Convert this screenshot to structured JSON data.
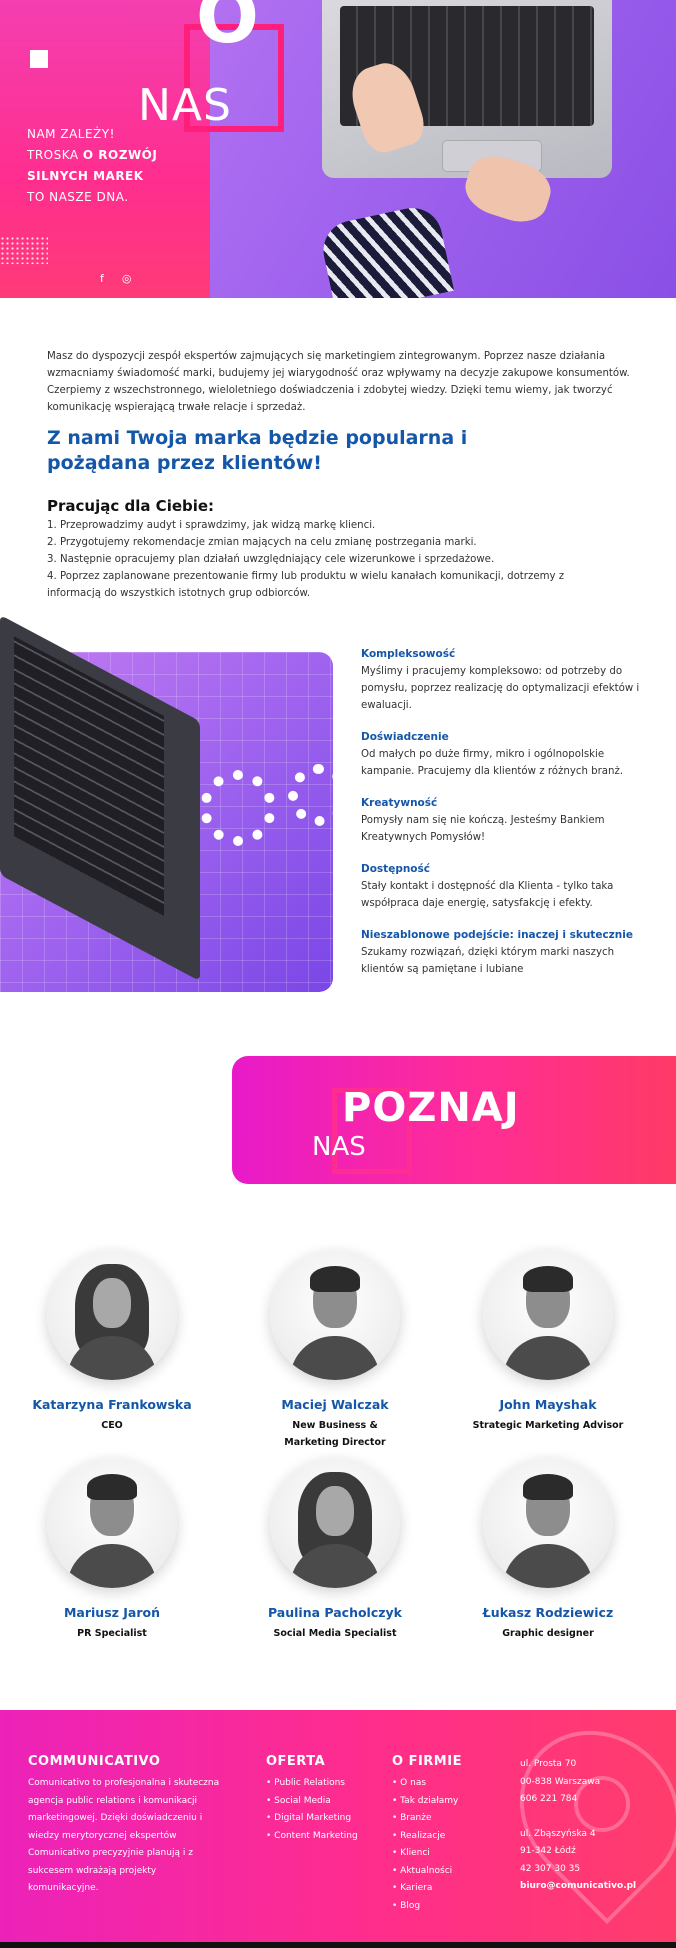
{
  "hero": {
    "title_o": "O",
    "title_nas": "NAS",
    "line1": "NAM ZALEŻY!",
    "line2_prefix": "TROSKA ",
    "line2_bold": "O ROZWÓJ",
    "line3": "SILNYCH MAREK",
    "line4": "TO NASZE DNA.",
    "social": {
      "facebook": "f",
      "instagram": "◎"
    }
  },
  "intro": {
    "paragraph": "Masz do dyspozycji zespół ekspertów zajmujących się marketingiem zintegrowanym. Poprzez nasze działania wzmacniamy świadomość marki, budujemy jej wiarygodność oraz wpływamy na decyzje zakupowe konsumentów. Czerpiemy z wszechstronnego, wieloletniego doświadczenia i zdobytej wiedzy. Dzięki temu wiemy, jak tworzyć komunikację wspierającą trwałe relacje i sprzedaż.",
    "slogan": "Z nami Twoja marka będzie popularna i pożądana przez klientów!",
    "working_title": "Pracując dla Ciebie:",
    "steps": [
      "1. Przeprowadzimy audyt i sprawdzimy, jak widzą markę klienci.",
      "2. Przygotujemy rekomendacje zmian mających na celu zmianę postrzegania marki.",
      "3. Następnie opracujemy plan działań uwzględniający cele wizerunkowe i sprzedażowe.",
      "4. Poprzez zaplanowane prezentowanie firmy lub produktu w wielu kanałach komunikacji, dotrzemy z informacją do wszystkich istotnych grup odbiorców."
    ]
  },
  "features": [
    {
      "title": "Kompleksowość",
      "desc": "Myślimy i pracujemy kompleksowo: od potrzeby do pomysłu, poprzez realizację do optymalizacji efektów i ewaluacji."
    },
    {
      "title": "Doświadczenie",
      "desc": "Od małych po duże firmy, mikro i ogólnopolskie kampanie. Pracujemy dla klientów z różnych branż."
    },
    {
      "title": "Kreatywność",
      "desc": "Pomysły nam się nie kończą. Jesteśmy Bankiem Kreatywnych Pomysłów!"
    },
    {
      "title": "Dostępność",
      "desc": "Stały kontakt i dostępność dla Klienta - tylko taka współpraca daje energię, satysfakcję i efekty."
    },
    {
      "title": "Nieszablonowe podejście: inaczej i skutecznie",
      "desc": "Szukamy rozwiązań, dzięki którym marki naszych klientów są pamiętane i lubiane"
    }
  ],
  "poznaj": {
    "big": "POZNAJ",
    "small": "NAS"
  },
  "team": [
    {
      "name": "Katarzyna Frankowska",
      "role": "CEO"
    },
    {
      "name": "Maciej Walczak",
      "role": "New Business & Marketing Director"
    },
    {
      "name": "John Mayshak",
      "role": "Strategic Marketing Advisor"
    },
    {
      "name": "Mariusz Jaroń",
      "role": "PR Specialist"
    },
    {
      "name": "Paulina Pacholczyk",
      "role": "Social Media Specialist"
    },
    {
      "name": "Łukasz Rodziewicz",
      "role": "Graphic designer"
    }
  ],
  "footer": {
    "brand": "COMMUNICATIVO",
    "about": "Comunicativo to profesjonalna i skuteczna agencja public relations i komunikacji marketingowej. Dzięki doświadczeniu i wiedzy merytorycznej ekspertów Comunicativo precyzyjnie planują i z sukcesem wdrażają projekty komunikacyjne.",
    "oferta_title": "OFERTA",
    "oferta": [
      "Public Relations",
      "Social Media",
      "Digital Marketing",
      "Content Marketing"
    ],
    "firma_title": "O FIRMIE",
    "firma": [
      "O nas",
      "Tak działamy",
      "Branże",
      "Realizacje",
      "Klienci",
      "Aktualności",
      "Kariera",
      "Blog"
    ],
    "address1": [
      "ul. Prosta 70",
      "00-838 Warszawa",
      "606 221 784"
    ],
    "address2": [
      "ul. Zbąszyńska 4",
      "91-342 Łódź",
      "42 307 30 35"
    ],
    "email": "biuro@comunicativo.pl"
  },
  "colors": {
    "accent_blue": "#1457a8",
    "pink": "#ff2d8c",
    "magenta": "#e81ac9",
    "purple": "#8a4fe6"
  }
}
